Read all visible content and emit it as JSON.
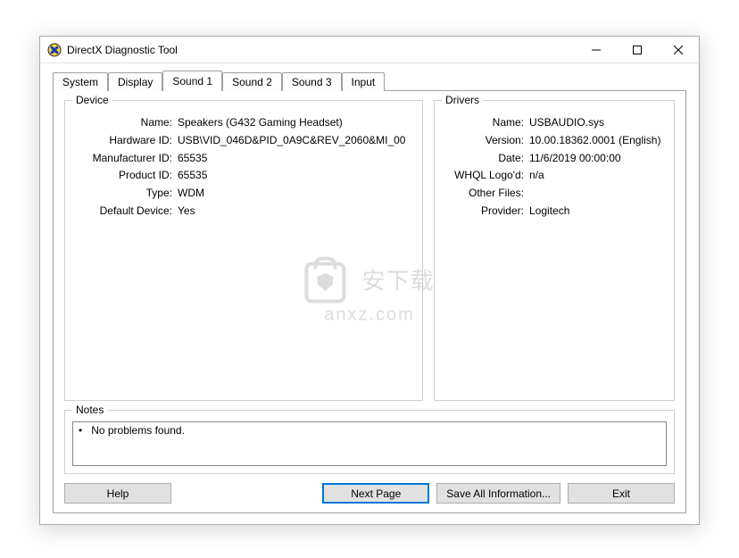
{
  "window": {
    "title": "DirectX Diagnostic Tool"
  },
  "tabs": [
    {
      "label": "System"
    },
    {
      "label": "Display"
    },
    {
      "label": "Sound 1"
    },
    {
      "label": "Sound 2"
    },
    {
      "label": "Sound 3"
    },
    {
      "label": "Input"
    }
  ],
  "active_tab_index": 2,
  "device": {
    "legend": "Device",
    "fields": {
      "name_label": "Name:",
      "name_value": "Speakers (G432 Gaming Headset)",
      "hwid_label": "Hardware ID:",
      "hwid_value": "USB\\VID_046D&PID_0A9C&REV_2060&MI_00",
      "mfr_label": "Manufacturer ID:",
      "mfr_value": "65535",
      "prod_label": "Product ID:",
      "prod_value": "65535",
      "type_label": "Type:",
      "type_value": "WDM",
      "default_label": "Default Device:",
      "default_value": "Yes"
    }
  },
  "drivers": {
    "legend": "Drivers",
    "fields": {
      "name_label": "Name:",
      "name_value": "USBAUDIO.sys",
      "version_label": "Version:",
      "version_value": "10.00.18362.0001 (English)",
      "date_label": "Date:",
      "date_value": "11/6/2019 00:00:00",
      "whql_label": "WHQL Logo'd:",
      "whql_value": "n/a",
      "other_label": "Other Files:",
      "other_value": "",
      "provider_label": "Provider:",
      "provider_value": "Logitech"
    }
  },
  "notes": {
    "legend": "Notes",
    "items": [
      "No problems found."
    ]
  },
  "buttons": {
    "help": "Help",
    "next": "Next Page",
    "save": "Save All Information...",
    "exit": "Exit"
  },
  "watermark": {
    "line1": "安下载",
    "line2": "anxz.com"
  }
}
